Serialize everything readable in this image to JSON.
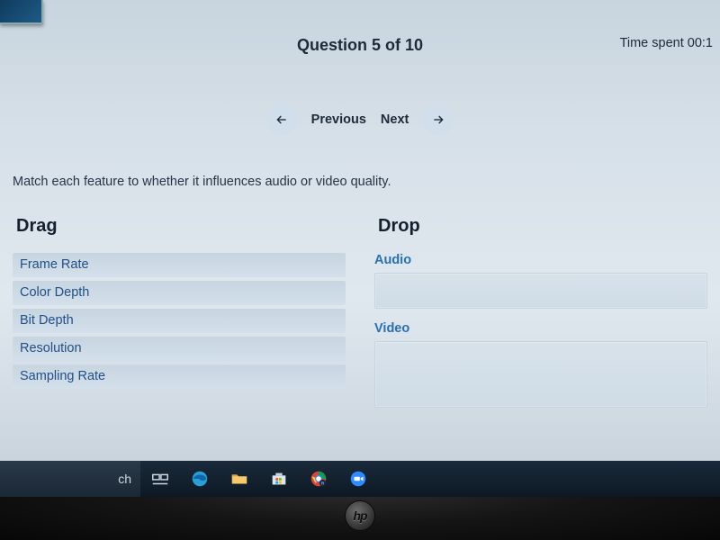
{
  "header": {
    "question_counter": "Question 5 of 10",
    "time_label": "Time spent 00:1"
  },
  "nav": {
    "previous": "Previous",
    "next": "Next"
  },
  "instruction": "Match each feature to whether it influences audio or video quality.",
  "drag": {
    "heading": "Drag",
    "items": [
      "Frame Rate",
      "Color Depth",
      "Bit Depth",
      "Resolution",
      "Sampling Rate"
    ]
  },
  "drop": {
    "heading": "Drop",
    "targets": [
      {
        "label": "Audio"
      },
      {
        "label": "Video"
      }
    ]
  },
  "taskbar": {
    "search_fragment": "ch"
  },
  "logo": "hp"
}
